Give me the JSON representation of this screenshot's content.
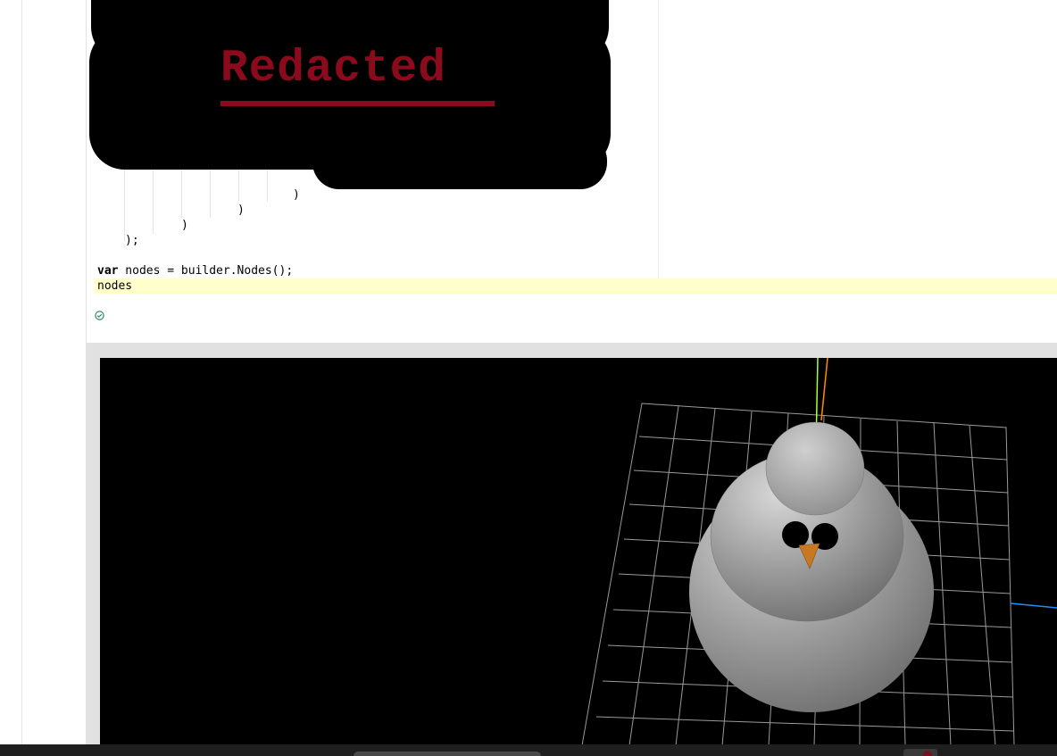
{
  "redaction": {
    "label": "Redacted"
  },
  "code": {
    "closing_lines": [
      ")",
      ")",
      ")",
      ");"
    ],
    "statement": {
      "keyword": "var",
      "rest": " nodes = builder.Nodes();"
    },
    "current_line": "nodes"
  },
  "status": {
    "icon": "check-circle-icon",
    "color": "#2e8b57"
  },
  "viewport": {
    "background": "#000000",
    "scene_objects": [
      "grid-floor",
      "snowman-body",
      "snowman-head",
      "eyes",
      "carrot-nose",
      "axis-lines"
    ],
    "axis_colors": {
      "x": "#1e90ff",
      "y": "#adff2f",
      "z": "#ff8c00"
    }
  }
}
